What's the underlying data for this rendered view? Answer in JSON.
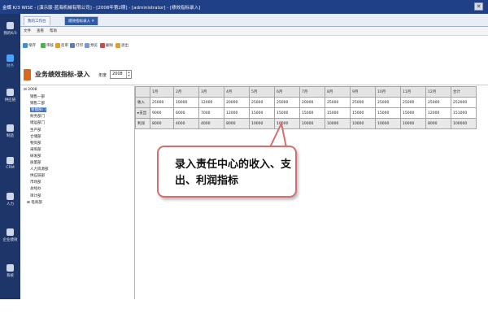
{
  "window": {
    "title": "金蝶 K/3 WISE - [演示版-蓝海机械有限公司] - [2008年第2期] - [administrator] - [绩效指标录入]",
    "close_glyph": "✕"
  },
  "leftnav": [
    {
      "label": "我的K/3",
      "icon": "my-k3-icon",
      "active": false
    },
    {
      "label": "财务",
      "icon": "finance-icon",
      "active": true
    },
    {
      "label": "供应链",
      "icon": "supply-chain-icon",
      "active": false
    },
    {
      "label": "制造",
      "icon": "manufacturing-icon",
      "active": false
    },
    {
      "label": "CRM",
      "icon": "crm-icon",
      "active": false
    },
    {
      "label": "人力",
      "icon": "hr-icon",
      "active": false
    },
    {
      "label": "企业绩效",
      "icon": "performance-icon",
      "active": false
    },
    {
      "label": "系统",
      "icon": "system-icon",
      "active": false
    }
  ],
  "tabs": [
    {
      "label": "我的工作台",
      "active": false
    },
    {
      "label": "绩效指标录入 ✕",
      "active": true
    }
  ],
  "menubar": [
    "文件",
    "查看",
    "帮助"
  ],
  "toolbar": [
    {
      "label": "保存",
      "icon": "save-icon",
      "color": "#3b8fd6"
    },
    {
      "label": "审核",
      "icon": "audit-icon",
      "color": "#4caf50"
    },
    {
      "label": "反审",
      "icon": "unaudit-icon",
      "color": "#e39b2a"
    },
    {
      "label": "打印",
      "icon": "print-icon",
      "color": "#5f7db8"
    },
    {
      "label": "预览",
      "icon": "preview-icon",
      "color": "#7c9ac9"
    },
    {
      "label": "删除",
      "icon": "delete-icon",
      "color": "#c94b4b"
    },
    {
      "label": "退出",
      "icon": "exit-icon",
      "color": "#e0a030"
    }
  ],
  "page": {
    "title": "业务绩效指标-录入",
    "year_label": "年度",
    "year_value": "2008"
  },
  "tree": {
    "root": "2008",
    "children": [
      "销售一部",
      "销售二部",
      "管理部门",
      "财务部门",
      "储运部门",
      "生产部",
      "仓储部",
      "物资部",
      "采购部",
      "研发部",
      "质量部",
      "人力资源部",
      "供应链部",
      "市场部",
      "总经办",
      "审计部",
      "电商部"
    ],
    "selected_index": 2,
    "expandable_index": 16
  },
  "grid": {
    "columns": [
      "",
      "1月",
      "2月",
      "3月",
      "4月",
      "5月",
      "6月",
      "7月",
      "8月",
      "9月",
      "10月",
      "11月",
      "12月",
      "合计"
    ],
    "rows": [
      {
        "name": "收入",
        "pointer": "",
        "values": [
          "25000",
          "10000",
          "12000",
          "20000",
          "25000",
          "25000",
          "20000",
          "25000",
          "25000",
          "25000",
          "25000",
          "25000",
          "252000"
        ]
      },
      {
        "name": "支出",
        "pointer": "▸",
        "values": [
          "9000",
          "6000",
          "7000",
          "12000",
          "15000",
          "15000",
          "15000",
          "15000",
          "15000",
          "15000",
          "15000",
          "12000",
          "151000"
        ]
      },
      {
        "name": "利润",
        "pointer": "",
        "values": [
          "8000",
          "4000",
          "4000",
          "8000",
          "10000",
          "10000",
          "10000",
          "10000",
          "10000",
          "10000",
          "10000",
          "8000",
          "100000"
        ]
      }
    ]
  },
  "callout": {
    "text": "录入责任中心的收入、支出、利润指标",
    "border_color": "#d96d6d"
  },
  "colors": {
    "titlebar": "#1f3f86",
    "leftnav": "#1d3569",
    "active_tab": "#2f5aa8",
    "page_badge": "#d86a1e",
    "selected_tree": "#3a6fc6"
  }
}
